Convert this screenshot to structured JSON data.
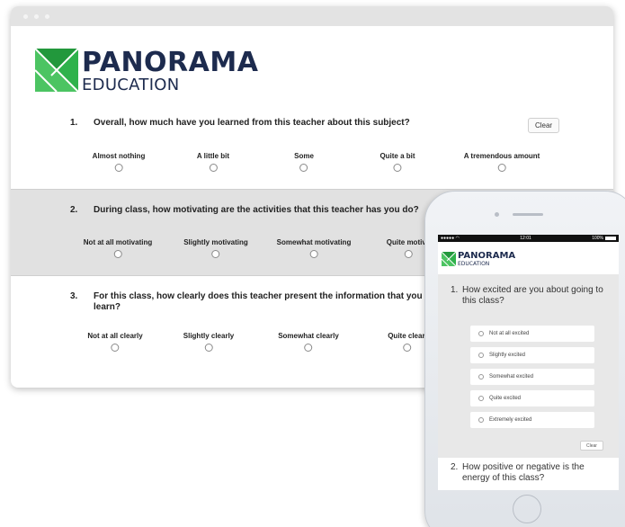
{
  "brand": {
    "name": "PANORAMA",
    "sub": "EDUCATION",
    "colors": {
      "navy": "#1d2b4e",
      "green": "#2fb24c"
    }
  },
  "clear_label": "Clear",
  "desktop": {
    "questions": [
      {
        "number": "1.",
        "text": "Overall, how much have you learned from this teacher about this subject?",
        "options": [
          "Almost nothing",
          "A little bit",
          "Some",
          "Quite a bit",
          "A tremendous amount"
        ]
      },
      {
        "number": "2.",
        "text": "During class, how motivating are the activities that this teacher has you do?",
        "options": [
          "Not at all motivating",
          "Slightly motivating",
          "Somewhat motivating",
          "Quite motiva"
        ]
      },
      {
        "number": "3.",
        "text": "For this class, how clearly does this teacher present the information that you learn?",
        "options": [
          "Not at all clearly",
          "Slightly clearly",
          "Somewhat clearly",
          "Quite clearl"
        ]
      }
    ]
  },
  "mobile": {
    "status": {
      "time": "12:01",
      "battery": "100%"
    },
    "q1": {
      "number": "1.",
      "text": "How excited are you about going to this class?",
      "options": [
        "Not at all excited",
        "Slightly excited",
        "Somewhat excited",
        "Quite excited",
        "Extremely excited"
      ]
    },
    "q2": {
      "number": "2.",
      "text": "How positive or negative is the energy of this class?"
    }
  }
}
